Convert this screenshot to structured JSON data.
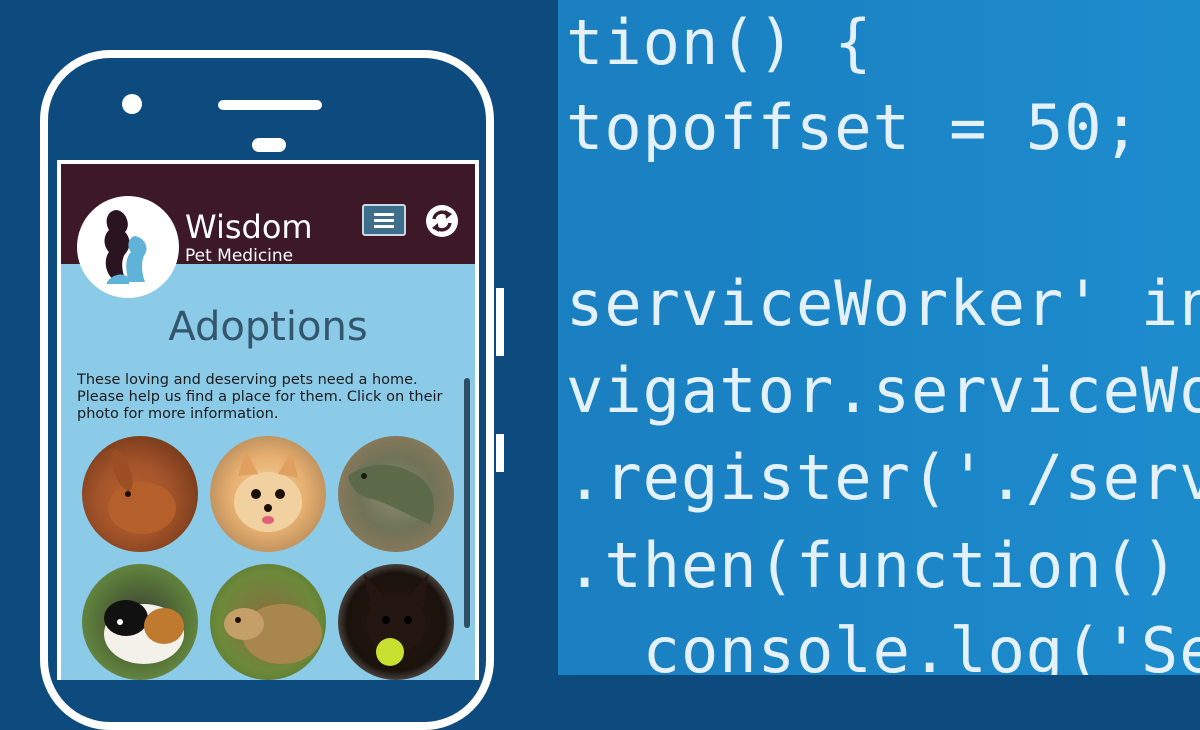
{
  "code": {
    "lines": [
      "tion() {",
      "topoffset = 50;",
      "",
      "serviceWorker' in",
      "vigator.serviceWo",
      ".register('./serv",
      ".then(function()",
      "  console.log('Se"
    ]
  },
  "app": {
    "brand_name": "Wisdom",
    "brand_sub": "Pet Medicine",
    "page_title": "Adoptions",
    "intro_text": "These loving and deserving pets need a home. Please help us find a place for them. Click on their photo for more information.",
    "pets": [
      {
        "animal": "rabbit"
      },
      {
        "animal": "pomeranian"
      },
      {
        "animal": "iguana"
      },
      {
        "animal": "guinea-pig"
      },
      {
        "animal": "tortoise"
      },
      {
        "animal": "chihuahua"
      }
    ]
  },
  "colors": {
    "background": "#0d4a7e",
    "code_panel": "#1b86c8",
    "app_header": "#3d1826",
    "app_body": "#8ccbe8"
  }
}
